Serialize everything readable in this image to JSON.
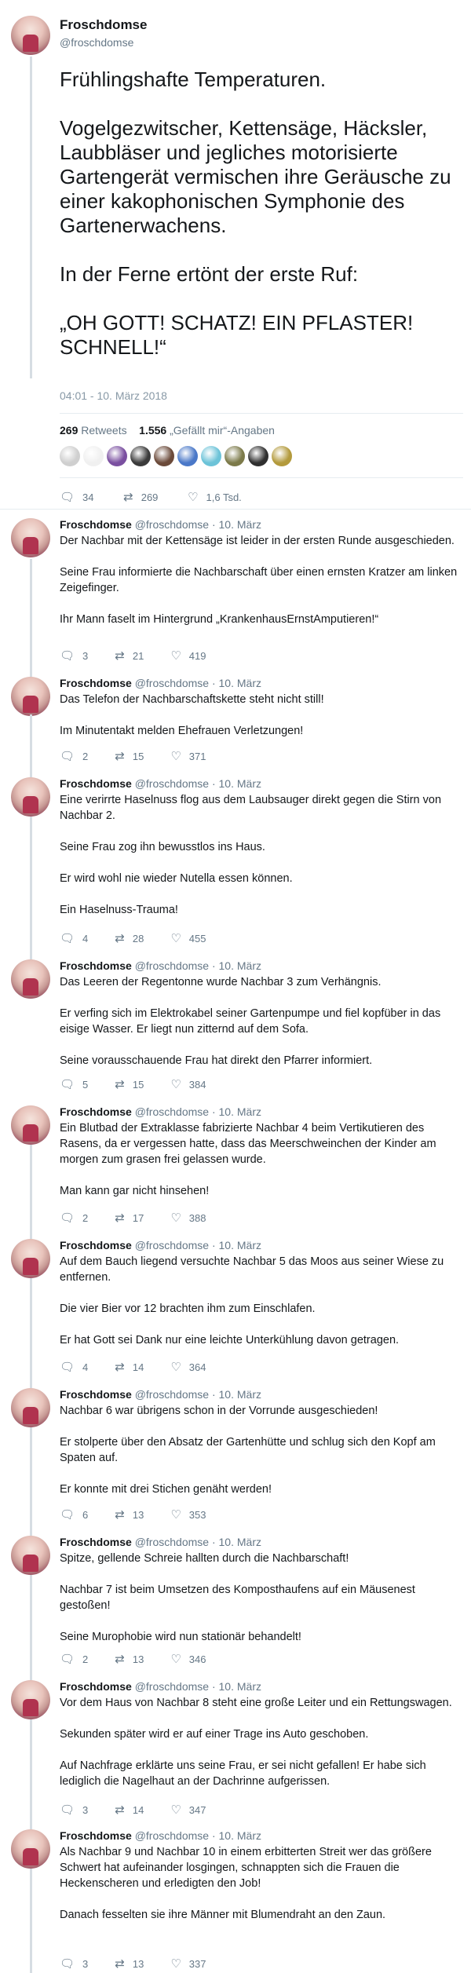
{
  "main": {
    "name": "Froschdomse",
    "handle": "@froschdomse",
    "paragraphs": [
      "Frühlingshafte Temperaturen.",
      "Vogelgezwitscher, Kettensäge, Häcksler, Laubbläser und jegliches motorisierte Gartengerät vermischen ihre Geräusche zu einer kakophonischen Symphonie des Gartenerwachens.",
      "In der Ferne ertönt der erste Ruf:",
      "„OH GOTT! SCHATZ! EIN PFLASTER! SCHNELL!“"
    ],
    "timestamp": "04:01 - 10. März 2018",
    "retweets_count": "269",
    "retweets_label": "Retweets",
    "likes_count": "1.556",
    "likes_label": "„Gefällt mir“-Angaben",
    "liker_colors": [
      "#cfcfcf",
      "#f0f0f0",
      "#7a4fa0",
      "#3b3b3b",
      "#6b4a3a",
      "#4a78c8",
      "#6cc3d8",
      "#7c7a4a",
      "#2f2f2f",
      "#b39a3c"
    ],
    "replies_count": "34",
    "retweet_count": "269",
    "like_count": "1,6 Tsd."
  },
  "icons": {
    "reply": "speech-bubble-icon",
    "retweet": "retweet-arrows-icon",
    "like": "heart-icon"
  },
  "replies": [
    {
      "name": "Froschdomse",
      "handle": "@froschdomse",
      "date": "10. März",
      "paragraphs": [
        "Der Nachbar mit der Kettensäge ist leider in der ersten Runde ausgeschieden.",
        "Seine Frau informierte die Nachbarschaft über einen ernsten Kratzer am linken Zeigefinger.",
        "Ihr Mann faselt im Hintergrund „KrankenhausErnstAmputieren!“"
      ],
      "replies": "3",
      "retweets": "21",
      "likes": "419"
    },
    {
      "name": "Froschdomse",
      "handle": "@froschdomse",
      "date": "10. März",
      "paragraphs": [
        "Das Telefon der Nachbarschaftskette steht nicht still!",
        "Im Minutentakt melden Ehefrauen Verletzungen!"
      ],
      "replies": "2",
      "retweets": "15",
      "likes": "371"
    },
    {
      "name": "Froschdomse",
      "handle": "@froschdomse",
      "date": "10. März",
      "paragraphs": [
        "Eine verirrte Haselnuss flog aus dem Laubsauger direkt gegen die Stirn von Nachbar 2.",
        "Seine Frau zog ihn bewusstlos ins Haus.",
        "Er wird wohl nie wieder Nutella essen können.",
        "Ein Haselnuss-Trauma!"
      ],
      "replies": "4",
      "retweets": "28",
      "likes": "455"
    },
    {
      "name": "Froschdomse",
      "handle": "@froschdomse",
      "date": "10. März",
      "paragraphs": [
        "Das Leeren der Regentonne wurde Nachbar 3 zum Verhängnis.",
        "Er verfing sich im Elektrokabel seiner Gartenpumpe und fiel kopfüber in das eisige Wasser. Er liegt nun zitternd auf dem Sofa.",
        "Seine vorausschauende Frau hat direkt den Pfarrer informiert."
      ],
      "replies": "5",
      "retweets": "15",
      "likes": "384"
    },
    {
      "name": "Froschdomse",
      "handle": "@froschdomse",
      "date": "10. März",
      "paragraphs": [
        "Ein Blutbad der Extraklasse fabrizierte Nachbar 4 beim Vertikutieren des Rasens, da er vergessen hatte, dass das Meerschweinchen der Kinder am morgen zum grasen frei gelassen wurde.",
        "Man kann gar nicht hinsehen!"
      ],
      "replies": "2",
      "retweets": "17",
      "likes": "388"
    },
    {
      "name": "Froschdomse",
      "handle": "@froschdomse",
      "date": "10. März",
      "paragraphs": [
        "Auf dem Bauch liegend versuchte Nachbar 5 das Moos aus seiner Wiese zu entfernen.",
        "Die vier Bier vor 12 brachten ihm zum Einschlafen.",
        "Er hat Gott sei Dank nur eine leichte Unterkühlung davon getragen."
      ],
      "replies": "4",
      "retweets": "14",
      "likes": "364"
    },
    {
      "name": "Froschdomse",
      "handle": "@froschdomse",
      "date": "10. März",
      "paragraphs": [
        "Nachbar 6 war übrigens schon in der Vorrunde ausgeschieden!",
        "Er stolperte über den Absatz der Gartenhütte und schlug sich den Kopf am Spaten auf.",
        "Er konnte mit drei Stichen genäht werden!"
      ],
      "replies": "6",
      "retweets": "13",
      "likes": "353"
    },
    {
      "name": "Froschdomse",
      "handle": "@froschdomse",
      "date": "10. März",
      "paragraphs": [
        "Spitze, gellende Schreie hallten durch die Nachbarschaft!",
        "Nachbar 7 ist beim Umsetzen des Komposthaufens auf ein Mäusenest gestoßen!",
        "Seine Murophobie wird nun stationär behandelt!"
      ],
      "replies": "2",
      "retweets": "13",
      "likes": "346"
    },
    {
      "name": "Froschdomse",
      "handle": "@froschdomse",
      "date": "10. März",
      "paragraphs": [
        "Vor dem Haus von Nachbar 8 steht eine große Leiter und ein Rettungswagen.",
        "Sekunden später wird er auf einer Trage ins Auto geschoben.",
        "Auf Nachfrage erklärte uns seine Frau, er sei nicht gefallen! Er habe sich lediglich die Nagelhaut an der Dachrinne aufgerissen."
      ],
      "replies": "3",
      "retweets": "14",
      "likes": "347"
    },
    {
      "name": "Froschdomse",
      "handle": "@froschdomse",
      "date": "10. März",
      "paragraphs": [
        "Als Nachbar 9 und Nachbar 10 in einem erbitterten Streit wer das größere Schwert hat aufeinander losgingen, schnappten sich die Frauen die Heckenscheren und erledigten den Job!",
        "Danach fesselten sie ihre Männer mit Blumendraht an den Zaun."
      ],
      "replies": "3",
      "retweets": "13",
      "likes": "337"
    }
  ]
}
